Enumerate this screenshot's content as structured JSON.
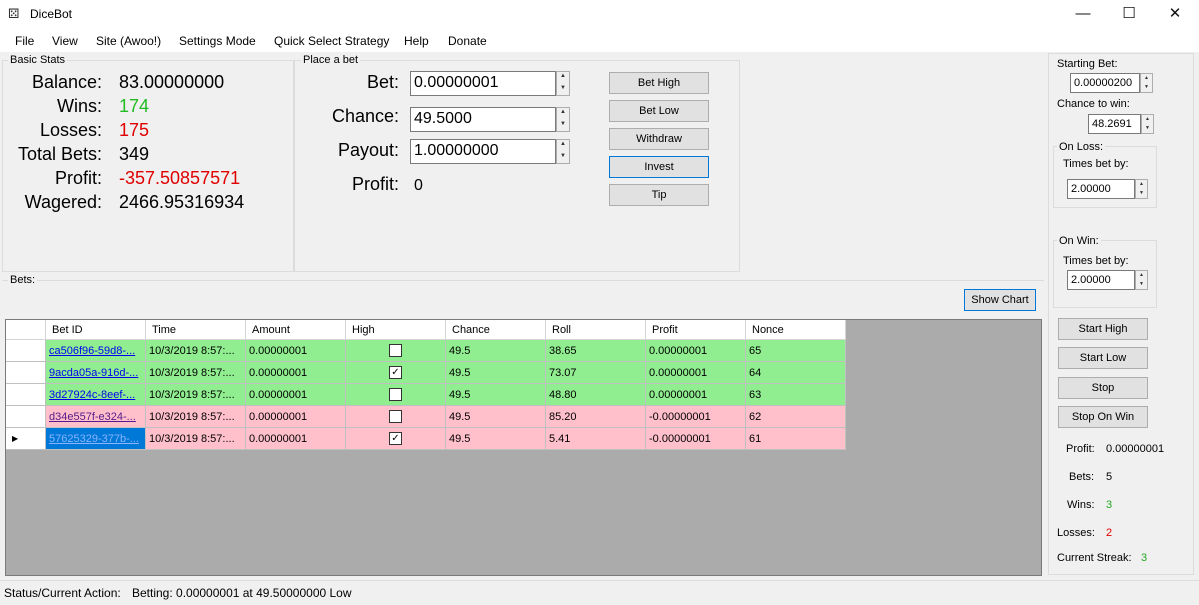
{
  "window": {
    "title": "DiceBot",
    "icon": "dice-icon",
    "controls": {
      "minimize": "—",
      "maximize": "☐",
      "close": "✕"
    }
  },
  "menu": [
    "File",
    "View",
    "Site (Awoo!)",
    "Settings Mode",
    "Quick Select Strategy",
    "Help",
    "Donate"
  ],
  "basic_stats": {
    "title": "Basic Stats",
    "balance_label": "Balance:",
    "balance": "83.00000000",
    "wins_label": "Wins:",
    "wins": "174",
    "losses_label": "Losses:",
    "losses": "175",
    "total_bets_label": "Total Bets:",
    "total_bets": "349",
    "profit_label": "Profit:",
    "profit": "-357.50857571",
    "wagered_label": "Wagered:",
    "wagered": "2466.95316934",
    "colors": {
      "positive": "#22bb22",
      "negative": "#e00000"
    }
  },
  "place_bet": {
    "title": "Place a bet",
    "bet_label": "Bet:",
    "bet_value": "0.00000001",
    "chance_label": "Chance:",
    "chance_value": "49.5000",
    "payout_label": "Payout:",
    "payout_value": "1.00000000",
    "profit_label": "Profit:",
    "profit_value": "0",
    "buttons": {
      "bet_high": "Bet High",
      "bet_low": "Bet Low",
      "withdraw": "Withdraw",
      "invest": "Invest",
      "tip": "Tip"
    }
  },
  "bets": {
    "title": "Bets:",
    "show_chart": "Show Chart",
    "columns": [
      "Bet ID",
      "Time",
      "Amount",
      "High",
      "Chance",
      "Roll",
      "Profit",
      "Nonce"
    ],
    "rows": [
      {
        "bet_id": "ca506f96-59d8-...",
        "time": "10/3/2019 8:57:...",
        "amount": "0.00000001",
        "high": false,
        "chance": "49.5",
        "roll": "38.65",
        "profit": "0.00000001",
        "nonce": "65",
        "result": "win"
      },
      {
        "bet_id": "9acda05a-916d-...",
        "time": "10/3/2019 8:57:...",
        "amount": "0.00000001",
        "high": true,
        "chance": "49.5",
        "roll": "73.07",
        "profit": "0.00000001",
        "nonce": "64",
        "result": "win"
      },
      {
        "bet_id": "3d27924c-8eef-...",
        "time": "10/3/2019 8:57:...",
        "amount": "0.00000001",
        "high": false,
        "chance": "49.5",
        "roll": "48.80",
        "profit": "0.00000001",
        "nonce": "63",
        "result": "win"
      },
      {
        "bet_id": "d34e557f-e324-...",
        "time": "10/3/2019 8:57:...",
        "amount": "0.00000001",
        "high": false,
        "chance": "49.5",
        "roll": "85.20",
        "profit": "-0.00000001",
        "nonce": "62",
        "result": "loss"
      },
      {
        "bet_id": "57625329-377b-...",
        "time": "10/3/2019 8:57:...",
        "amount": "0.00000001",
        "high": true,
        "chance": "49.5",
        "roll": "5.41",
        "profit": "-0.00000001",
        "nonce": "61",
        "result": "loss"
      }
    ],
    "colors": {
      "win": "#90ee90",
      "loss": "#ffc0cb",
      "selected_id": "#0078d7"
    }
  },
  "right_panel": {
    "starting_bet_label": "Starting Bet:",
    "starting_bet": "0.00000200",
    "chance_label": "Chance to win:",
    "chance": "48.2691",
    "on_loss_title": "On Loss:",
    "on_loss_times_label": "Times bet by:",
    "on_loss_times": "2.00000",
    "on_win_title": "On Win:",
    "on_win_times_label": "Times bet by:",
    "on_win_times": "2.00000",
    "buttons": {
      "start_high": "Start High",
      "start_low": "Start Low",
      "stop": "Stop",
      "stop_on_win": "Stop On Win"
    },
    "profit_label": "Profit:",
    "profit": "0.00000001",
    "bets_label": "Bets:",
    "bets": "5",
    "wins_label": "Wins:",
    "wins": "3",
    "losses_label": "Losses:",
    "losses": "2",
    "streak_label": "Current Streak:",
    "streak": "3"
  },
  "status": {
    "label": "Status/Current Action:",
    "text": "Betting: 0.00000001 at 49.50000000 Low"
  }
}
